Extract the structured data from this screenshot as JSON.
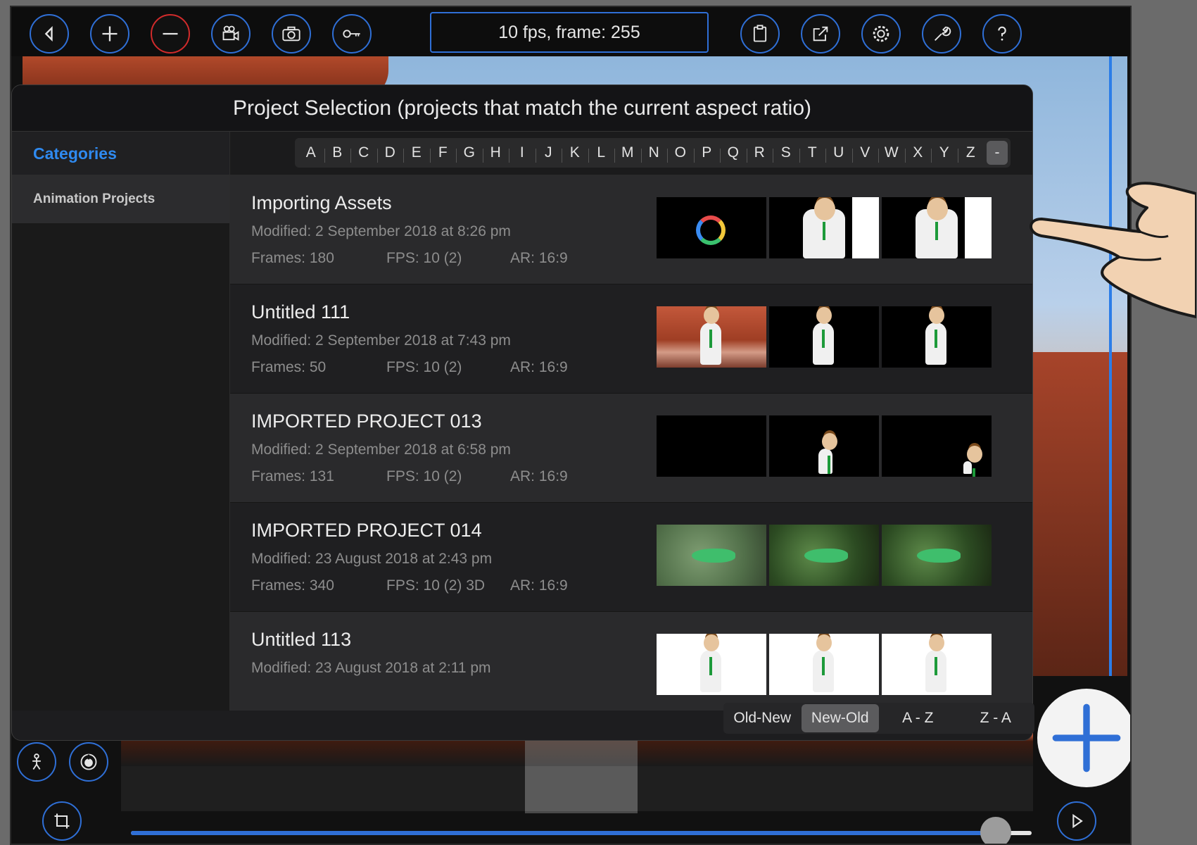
{
  "toolbar": {
    "frame_info": "10 fps, frame: 255",
    "buttons": [
      "back-icon",
      "plus-icon",
      "minus-icon",
      "video-camera-icon",
      "camera-icon",
      "key-icon",
      "clipboard-icon",
      "export-icon",
      "gear-icon",
      "wrench-icon",
      "help-icon"
    ]
  },
  "panel": {
    "title": "Project Selection (projects that match the current aspect ratio)",
    "categories_label": "Categories",
    "category_item": "Animation Projects",
    "letters": [
      "A",
      "B",
      "C",
      "D",
      "E",
      "F",
      "G",
      "H",
      "I",
      "J",
      "K",
      "L",
      "M",
      "N",
      "O",
      "P",
      "Q",
      "R",
      "S",
      "T",
      "U",
      "V",
      "W",
      "X",
      "Y",
      "Z",
      "-"
    ],
    "selected_letter": "-",
    "projects": [
      {
        "name": "Importing Assets",
        "modified": "Modified: 2 September 2018 at 8:26 pm",
        "frames": "Frames: 180",
        "fps": "FPS: 10 (2)",
        "ar": "AR: 16:9"
      },
      {
        "name": "Untitled 111",
        "modified": "Modified: 2 September 2018 at 7:43 pm",
        "frames": "Frames: 50",
        "fps": "FPS: 10 (2)",
        "ar": "AR: 16:9"
      },
      {
        "name": "IMPORTED PROJECT 013",
        "modified": "Modified: 2 September 2018 at 6:58 pm",
        "frames": "Frames: 131",
        "fps": "FPS: 10 (2)",
        "ar": "AR: 16:9"
      },
      {
        "name": "IMPORTED PROJECT 014",
        "modified": "Modified: 23 August 2018 at 2:43 pm",
        "frames": "Frames: 340",
        "fps": "FPS: 10 (2) 3D",
        "ar": "AR: 16:9"
      },
      {
        "name": "Untitled 113",
        "modified": "Modified: 23 August 2018 at 2:11 pm",
        "frames": "",
        "fps": "",
        "ar": ""
      }
    ]
  },
  "sort": {
    "options": [
      "Old-New",
      "New-Old",
      "A - Z",
      "Z - A"
    ],
    "selected": "New-Old"
  },
  "playback": {
    "slider_position": 0.96
  },
  "colors": {
    "accent": "#2f6fd6",
    "category_blue": "#2f8af0",
    "minus_ring": "#d12b2b"
  }
}
